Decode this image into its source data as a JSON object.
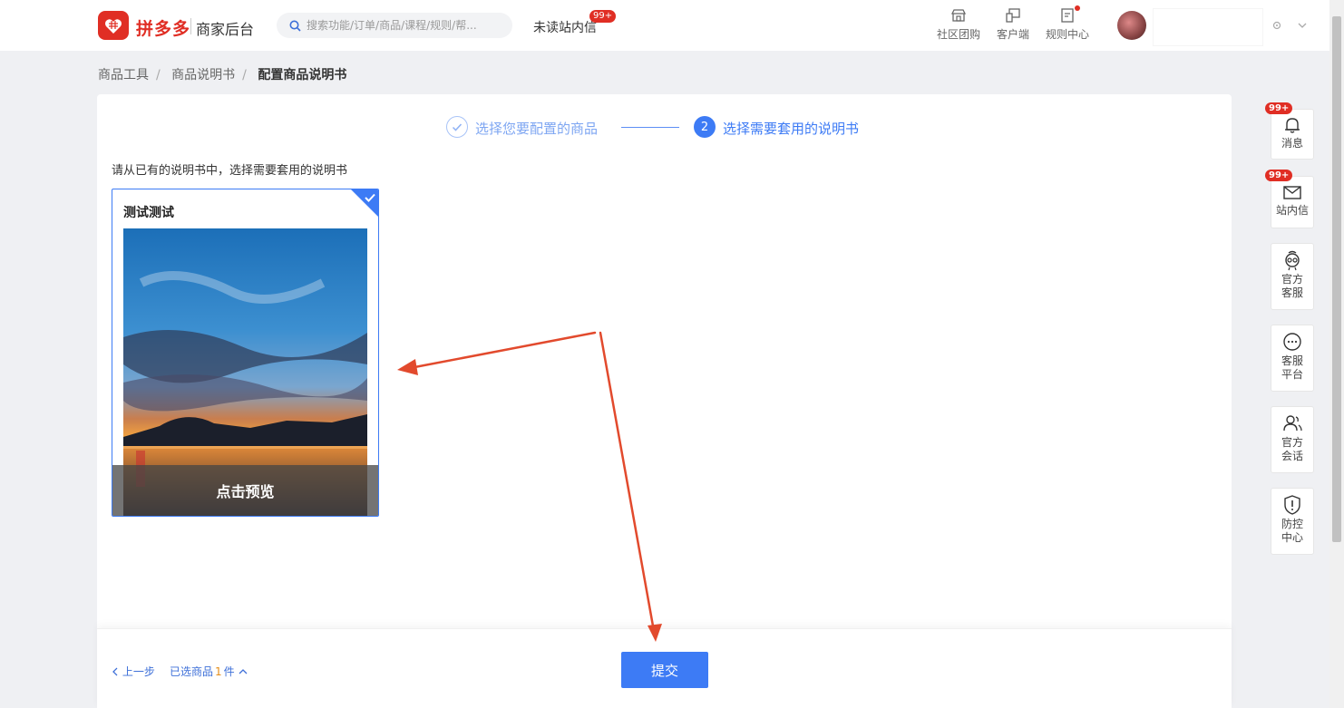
{
  "header": {
    "brand": "拼多多",
    "brand_sub": "商家后台",
    "search_placeholder": "搜索功能/订单/商品/课程/规则/帮...",
    "unread_label": "未读站内信",
    "unread_badge": "99+",
    "tools": [
      {
        "label": "社区团购",
        "icon": "store-icon"
      },
      {
        "label": "客户端",
        "icon": "devices-icon"
      },
      {
        "label": "规则中心",
        "icon": "document-icon"
      }
    ]
  },
  "breadcrumb": {
    "items": [
      "商品工具",
      "商品说明书"
    ],
    "current": "配置商品说明书"
  },
  "steps": {
    "step1": "选择您要配置的商品",
    "step2_number": "2",
    "step2": "选择需要套用的说明书"
  },
  "hint": "请从已有的说明书中，选择需要套用的说明书",
  "card": {
    "title": "测试测试",
    "preview_label": "点击预览"
  },
  "footer": {
    "prev_label": "上一步",
    "selected_prefix": "已选商品",
    "selected_count": "1",
    "selected_suffix": "件",
    "submit_label": "提交"
  },
  "sidebar": {
    "items": [
      {
        "label": "消息",
        "badge": "99+"
      },
      {
        "label": "站内信",
        "badge": "99+"
      },
      {
        "label": "官方客服"
      },
      {
        "label": "客服平台"
      },
      {
        "label": "官方会话"
      },
      {
        "label": "防控中心"
      }
    ]
  },
  "colors": {
    "brand_red": "#e02e24",
    "primary_blue": "#3d7bf5",
    "annotation_arrow": "#e24a2d"
  }
}
